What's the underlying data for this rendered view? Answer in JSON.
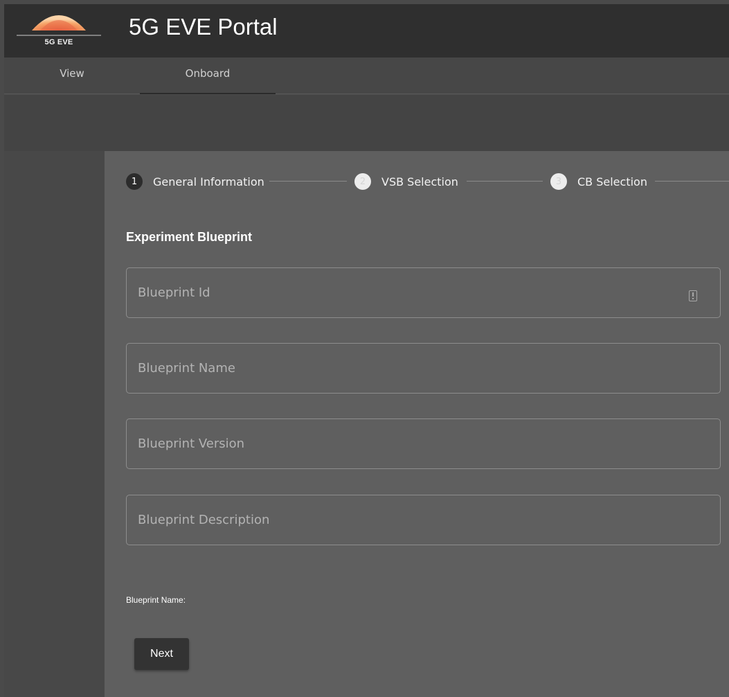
{
  "header": {
    "logo_text": "5G EVE",
    "title": "5G EVE Portal"
  },
  "tabs": [
    {
      "label": "View",
      "active": false
    },
    {
      "label": "Onboard",
      "active": true
    }
  ],
  "stepper": {
    "steps": [
      {
        "number": "1",
        "label": "General Information",
        "state": "active"
      },
      {
        "number": "2",
        "label": "VSB Selection",
        "state": "inactive"
      },
      {
        "number": "3",
        "label": "CB Selection",
        "state": "inactive"
      }
    ]
  },
  "form": {
    "section_title": "Experiment Blueprint",
    "fields": [
      {
        "placeholder": "Blueprint Id",
        "value": ""
      },
      {
        "placeholder": "Blueprint Name",
        "value": ""
      },
      {
        "placeholder": "Blueprint Version",
        "value": ""
      },
      {
        "placeholder": "Blueprint Description",
        "value": ""
      }
    ],
    "summary_label": "Blueprint Name:",
    "next_label": "Next"
  },
  "colors": {
    "header_bg": "#2f2f2f",
    "card_bg": "#5f5f5f",
    "page_bg": "#4a4a4a",
    "button_bg": "#333333"
  }
}
